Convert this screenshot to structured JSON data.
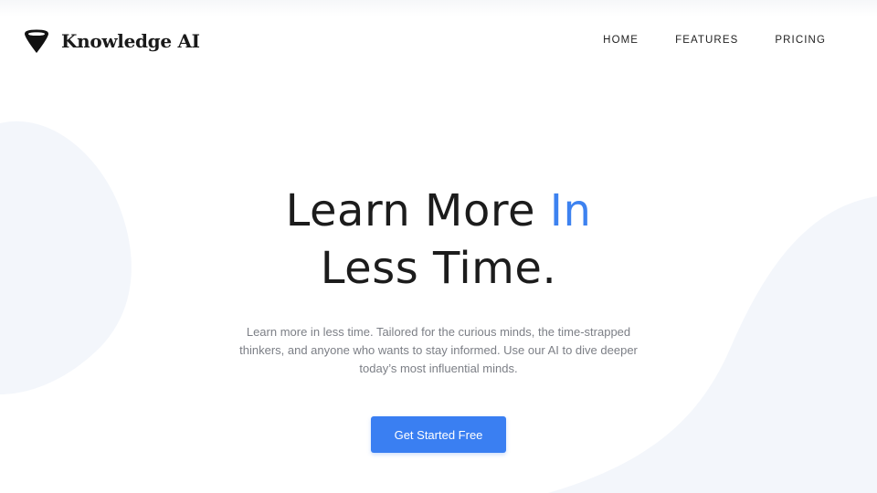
{
  "brand": {
    "name": "Knowledge AI",
    "logo_icon": "funnel-logo-icon"
  },
  "nav": {
    "items": [
      {
        "label": "HOME"
      },
      {
        "label": "FEATURES"
      },
      {
        "label": "PRICING"
      }
    ]
  },
  "hero": {
    "headline_part1": "Learn More ",
    "headline_accent": "In",
    "headline_part2": "Less Time.",
    "description": "Learn more in less time. Tailored for the curious minds, the time-strapped thinkers, and anyone who wants to stay informed. Use our AI to dive deeper today’s most influential minds.",
    "cta_label": "Get Started Free"
  },
  "colors": {
    "accent": "#3d82f0",
    "button": "#3a7ff2",
    "text": "#1c1c1c",
    "muted_text": "#7c7f86",
    "background_shape": "#f3f6fb"
  }
}
